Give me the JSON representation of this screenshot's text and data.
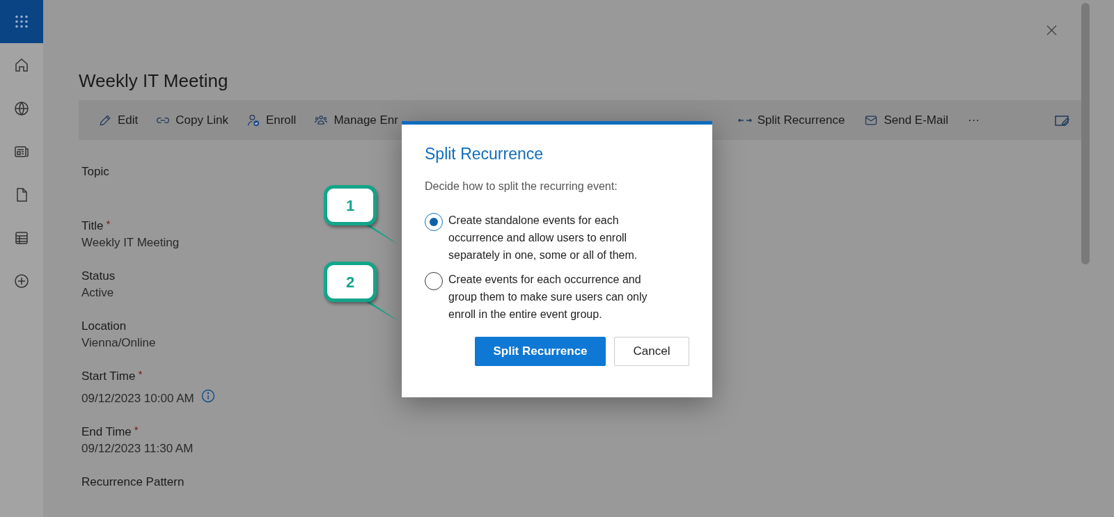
{
  "page": {
    "title": "Weekly IT Meeting"
  },
  "toolbar": {
    "items": [
      {
        "label": "Edit",
        "kind": "pencil"
      },
      {
        "label": "Copy Link",
        "kind": "link"
      },
      {
        "label": "Enroll",
        "kind": "enroll"
      },
      {
        "label": "Manage Enr",
        "kind": "people"
      }
    ],
    "right_items": [
      {
        "label": "Split Recurrence",
        "kind": "split"
      },
      {
        "label": "Send E-Mail",
        "kind": "mail"
      },
      {
        "label": "···",
        "kind": "more"
      }
    ]
  },
  "fields": [
    {
      "label": "Topic"
    },
    {
      "label": "Title",
      "marker": "*",
      "value": "Weekly IT Meeting",
      "info": false
    },
    {
      "label": "Status",
      "value": "Active",
      "info": false
    },
    {
      "label": "Location",
      "value": "Vienna/Online",
      "info": false
    },
    {
      "label": "Start Time",
      "marker": "*",
      "value": "09/12/2023 10:00 AM",
      "info": true
    },
    {
      "label": "End Time",
      "marker": "*",
      "value": "09/12/2023 11:30 AM",
      "info": false
    },
    {
      "label": "Recurrence Pattern"
    }
  ],
  "dialog": {
    "title": "Split Recurrence",
    "prompt": "Decide how to split the recurring event:",
    "options": [
      {
        "text": "Create standalone events for each occurrence and allow users to enroll separately in one, some or all of them.",
        "selected": true
      },
      {
        "text": "Create events for each occurrence and group them to make sure users can only enroll in the entire event group.",
        "selected": false
      }
    ],
    "buttons": [
      {
        "label": "Split Recurrence",
        "kind": "primary"
      },
      {
        "label": "Cancel",
        "kind": "secondary"
      }
    ]
  },
  "callouts": [
    "1",
    "2"
  ]
}
